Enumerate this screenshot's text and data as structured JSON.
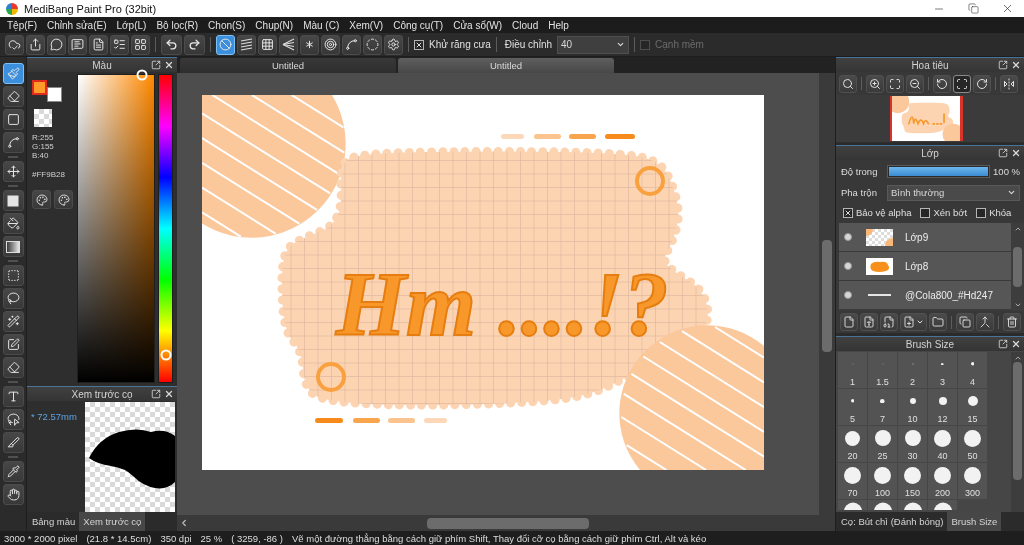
{
  "window": {
    "title": "MediBang Paint Pro (32bit)"
  },
  "menu": [
    "Tệp(F)",
    "Chỉnh sửa(E)",
    "Lớp(L)",
    "Bộ lọc(R)",
    "Chọn(S)",
    "Chụp(N)",
    "Màu (C)",
    "Xem(V)",
    "Công cụ(T)",
    "Cửa sổ(W)",
    "Cloud",
    "Help"
  ],
  "toolbar": {
    "snap_modes": [
      {
        "selected": true
      },
      {
        "selected": false
      },
      {
        "selected": false
      },
      {
        "selected": false
      },
      {
        "selected": false
      },
      {
        "selected": false
      },
      {
        "selected": false
      },
      {
        "selected": false
      }
    ],
    "antialias": {
      "label": "Khử răng cưa",
      "checked": true
    },
    "adjust": {
      "label": "Điều chỉnh",
      "value": "40"
    },
    "soft_edge": {
      "label": "Cạnh mềm",
      "checked": false,
      "disabled": true
    }
  },
  "tools": [
    {
      "selected": true
    },
    {
      "selected": false
    },
    {
      "selected": false
    },
    {
      "selected": false
    },
    {
      "selected": false
    },
    {
      "selected": false
    },
    {
      "selected": false
    },
    {
      "selected": false
    },
    {
      "selected": false
    },
    {
      "selected": false
    },
    {
      "selected": false
    },
    {
      "selected": false
    },
    {
      "selected": false
    },
    {
      "selected": false
    },
    {
      "selected": false
    },
    {
      "selected": false
    },
    {
      "selected": false
    },
    {
      "selected": false
    }
  ],
  "color_panel": {
    "title": "Màu",
    "foreground": {
      "color": "#ff9b28"
    },
    "background": {
      "color": "#ffffff"
    },
    "rgb": [
      "R:255",
      "G:155",
      "B:40"
    ],
    "hex": "#FF9B28"
  },
  "brush_preview": {
    "title": "Xem trước cọ",
    "size": "* 72.57mm"
  },
  "left_tabs": [
    {
      "label": "Bảng màu",
      "selected": false
    },
    {
      "label": "Xem trước cọ",
      "selected": true
    }
  ],
  "document_tabs": [
    {
      "label": "Untitled",
      "selected": false
    },
    {
      "label": "Untitled",
      "selected": true
    }
  ],
  "canvas": {
    "artwork_text": "Hm ....!?"
  },
  "navigator": {
    "title": "Hoa tiêu",
    "buttons": [
      {
        "selected": false
      },
      {
        "selected": false
      },
      {
        "selected": false
      },
      {
        "selected": false
      },
      {
        "selected": false
      },
      {
        "selected": true
      },
      {
        "selected": false
      },
      {
        "selected": false
      }
    ]
  },
  "layers_panel": {
    "title": "Lớp",
    "opacity": {
      "label": "Độ trong",
      "level": 1,
      "reading": "100 %"
    },
    "blend": {
      "label": "Pha trộn",
      "value": "Bình thường"
    },
    "options": [
      {
        "label": "Bảo vệ alpha",
        "checked": true
      },
      {
        "label": "Xén bớt",
        "checked": false
      },
      {
        "label": "Khóa",
        "checked": false
      }
    ],
    "layers": [
      {
        "name": "Lớp9",
        "visible": true,
        "kind": "corners"
      },
      {
        "name": "Lớp8",
        "visible": true,
        "kind": "blob"
      },
      {
        "name": "@Cola800_#Hd247",
        "visible": true,
        "kind": "text"
      }
    ]
  },
  "brush_size_panel": {
    "title": "Brush Size",
    "sizes": [
      {
        "kind": "size",
        "label": "1"
      },
      {
        "kind": "size",
        "label": "1.5"
      },
      {
        "kind": "size",
        "label": "2"
      },
      {
        "kind": "size",
        "label": "3"
      },
      {
        "kind": "size",
        "label": "4"
      },
      {
        "kind": "size",
        "label": "5"
      },
      {
        "kind": "size",
        "label": "7"
      },
      {
        "kind": "size",
        "label": "10"
      },
      {
        "kind": "size",
        "label": "12"
      },
      {
        "kind": "size",
        "label": "15"
      },
      {
        "kind": "size",
        "label": "20"
      },
      {
        "kind": "size",
        "label": "25"
      },
      {
        "kind": "size",
        "label": "30"
      },
      {
        "kind": "size",
        "label": "40"
      },
      {
        "kind": "size",
        "label": "50"
      },
      {
        "kind": "size",
        "label": "70"
      },
      {
        "kind": "size",
        "label": "100"
      },
      {
        "kind": "size",
        "label": "150"
      },
      {
        "kind": "size",
        "label": "200"
      },
      {
        "kind": "size",
        "label": "300"
      },
      {
        "kind": "partial"
      },
      {
        "kind": "partial"
      },
      {
        "kind": "partial"
      },
      {
        "kind": "partial"
      }
    ]
  },
  "right_tabs": [
    {
      "label": "Cọ: Bút chì (Đánh bóng)",
      "selected": false
    },
    {
      "label": "Brush Size",
      "selected": true
    }
  ],
  "status_bar": [
    "3000 * 2000 pixel",
    "(21.8 * 14.5cm)",
    "350 dpi",
    "25 %",
    "( 3259, -86 )",
    "Vẽ một đường thẳng bằng cách giữ phím Shift, Thay đổi cỡ cọ bằng cách giữ phím Ctrl, Alt và kéo"
  ]
}
